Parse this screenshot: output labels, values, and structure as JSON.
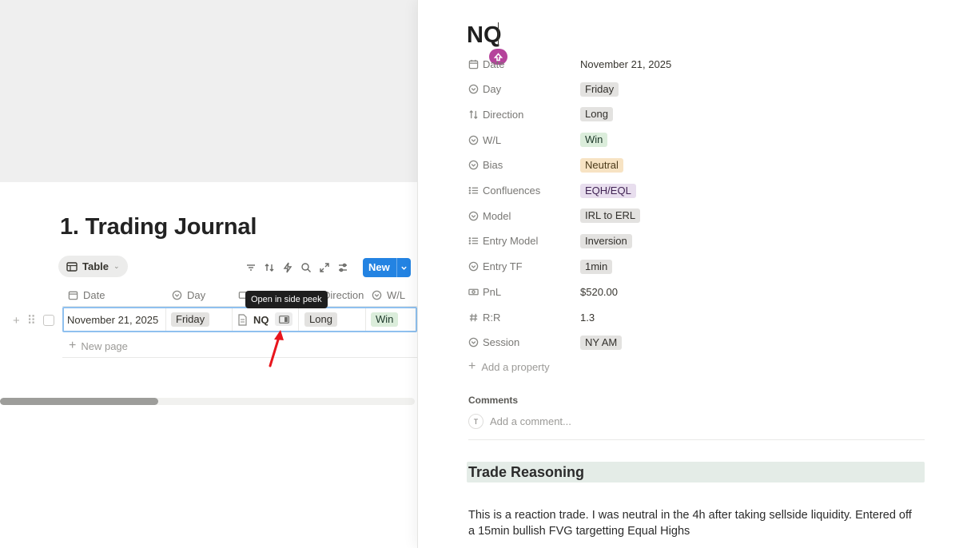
{
  "database": {
    "title": "1. Trading Journal",
    "view_tab": "Table",
    "new_button": "New",
    "columns": [
      "Date",
      "Day",
      "Name",
      "Direction",
      "W/L"
    ],
    "row": {
      "date": "November 21, 2025",
      "day": "Friday",
      "name": "NQ",
      "direction": "Long",
      "wl": "Win"
    },
    "new_page_label": "New page",
    "tooltip": "Open in side peek"
  },
  "peek": {
    "title": "NQ",
    "properties": [
      {
        "name": "Date",
        "icon": "calendar-icon",
        "value": "November 21, 2025",
        "style": "plain"
      },
      {
        "name": "Day",
        "icon": "select-icon",
        "value": "Friday",
        "style": "gray"
      },
      {
        "name": "Direction",
        "icon": "sort-icon",
        "value": "Long",
        "style": "gray"
      },
      {
        "name": "W/L",
        "icon": "select-icon",
        "value": "Win",
        "style": "green"
      },
      {
        "name": "Bias",
        "icon": "select-icon",
        "value": "Neutral",
        "style": "orange"
      },
      {
        "name": "Confluences",
        "icon": "list-icon",
        "value": "EQH/EQL",
        "style": "purple"
      },
      {
        "name": "Model",
        "icon": "select-icon",
        "value": "IRL to ERL",
        "style": "gray"
      },
      {
        "name": "Entry Model",
        "icon": "list-icon",
        "value": "Inversion",
        "style": "gray"
      },
      {
        "name": "Entry TF",
        "icon": "select-icon",
        "value": "1min",
        "style": "gray"
      },
      {
        "name": "PnL",
        "icon": "money-icon",
        "value": "$520.00",
        "style": "plain"
      },
      {
        "name": "R:R",
        "icon": "hash-icon",
        "value": "1.3",
        "style": "plain"
      },
      {
        "name": "Session",
        "icon": "select-icon",
        "value": "NY AM",
        "style": "gray"
      }
    ],
    "add_property": "Add a property",
    "comments_heading": "Comments",
    "avatar_initial": "T",
    "comment_placeholder": "Add a comment...",
    "section_heading": "Trade Reasoning",
    "body": "This is a reaction trade. I was neutral in the 4h after taking sellside liquidity. Entered off a 15min bullish FVG targetting Equal Highs"
  }
}
